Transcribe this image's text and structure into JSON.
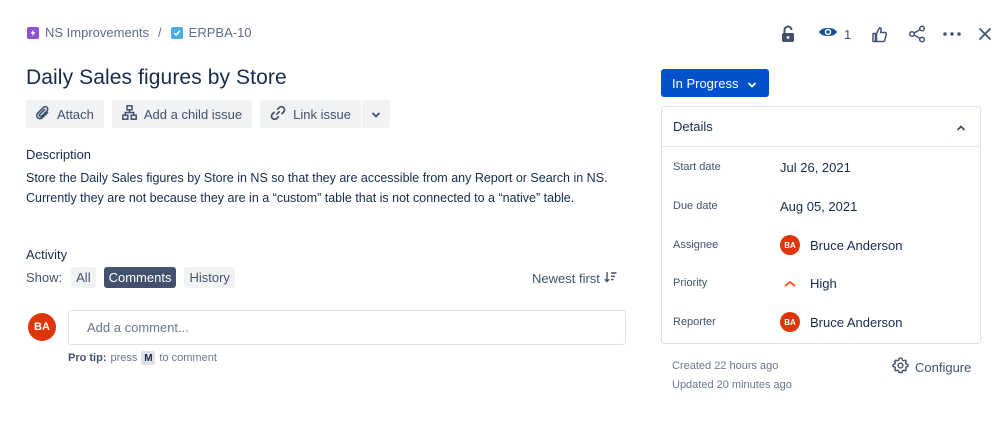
{
  "breadcrumbs": {
    "project": "NS Improvements",
    "separator": "/",
    "issue_key": "ERPBA-10"
  },
  "header_actions": {
    "lock_icon": "lock-open-icon",
    "watch_icon": "eye-icon",
    "watch_count": "1",
    "like_icon": "thumbs-up-icon",
    "share_icon": "share-icon",
    "more_icon": "more-horizontal-icon",
    "close_icon": "close-icon"
  },
  "issue": {
    "title": "Daily Sales figures by Store"
  },
  "toolbar": {
    "attach_label": "Attach",
    "child_issue_label": "Add a child issue",
    "link_issue_label": "Link issue"
  },
  "description": {
    "label": "Description",
    "line1": "Store the Daily Sales figures by Store in NS so that they are accessible from any Report or Search in NS.",
    "line2": "Currently they are not because they are in a “custom”  table that is not connected to a “native” table."
  },
  "activity": {
    "label": "Activity",
    "show_label": "Show:",
    "filters": [
      "All",
      "Comments",
      "History"
    ],
    "active_filter": "Comments",
    "sort_label": "Newest first"
  },
  "comment": {
    "avatar_initials": "BA",
    "placeholder": "Add a comment...",
    "protip_bold": "Pro tip:",
    "protip_press": "press",
    "protip_key": "M",
    "protip_rest": "to comment"
  },
  "status": {
    "label": "In Progress"
  },
  "details": {
    "header": "Details",
    "start_date_label": "Start date",
    "start_date": "Jul 26, 2021",
    "due_date_label": "Due date",
    "due_date": "Aug 05, 2021",
    "assignee_label": "Assignee",
    "assignee_initials": "BA",
    "assignee": "Bruce Anderson",
    "priority_label": "Priority",
    "priority": "High",
    "reporter_label": "Reporter",
    "reporter_initials": "BA",
    "reporter": "Bruce Anderson"
  },
  "meta": {
    "created": "Created 22 hours ago",
    "updated": "Updated 20 minutes ago",
    "configure_label": "Configure"
  },
  "colors": {
    "primary": "#0052cc",
    "avatar": "#de350b",
    "priority_high": "#ff5630",
    "text": "#172b4d",
    "subtle": "#42526e"
  }
}
